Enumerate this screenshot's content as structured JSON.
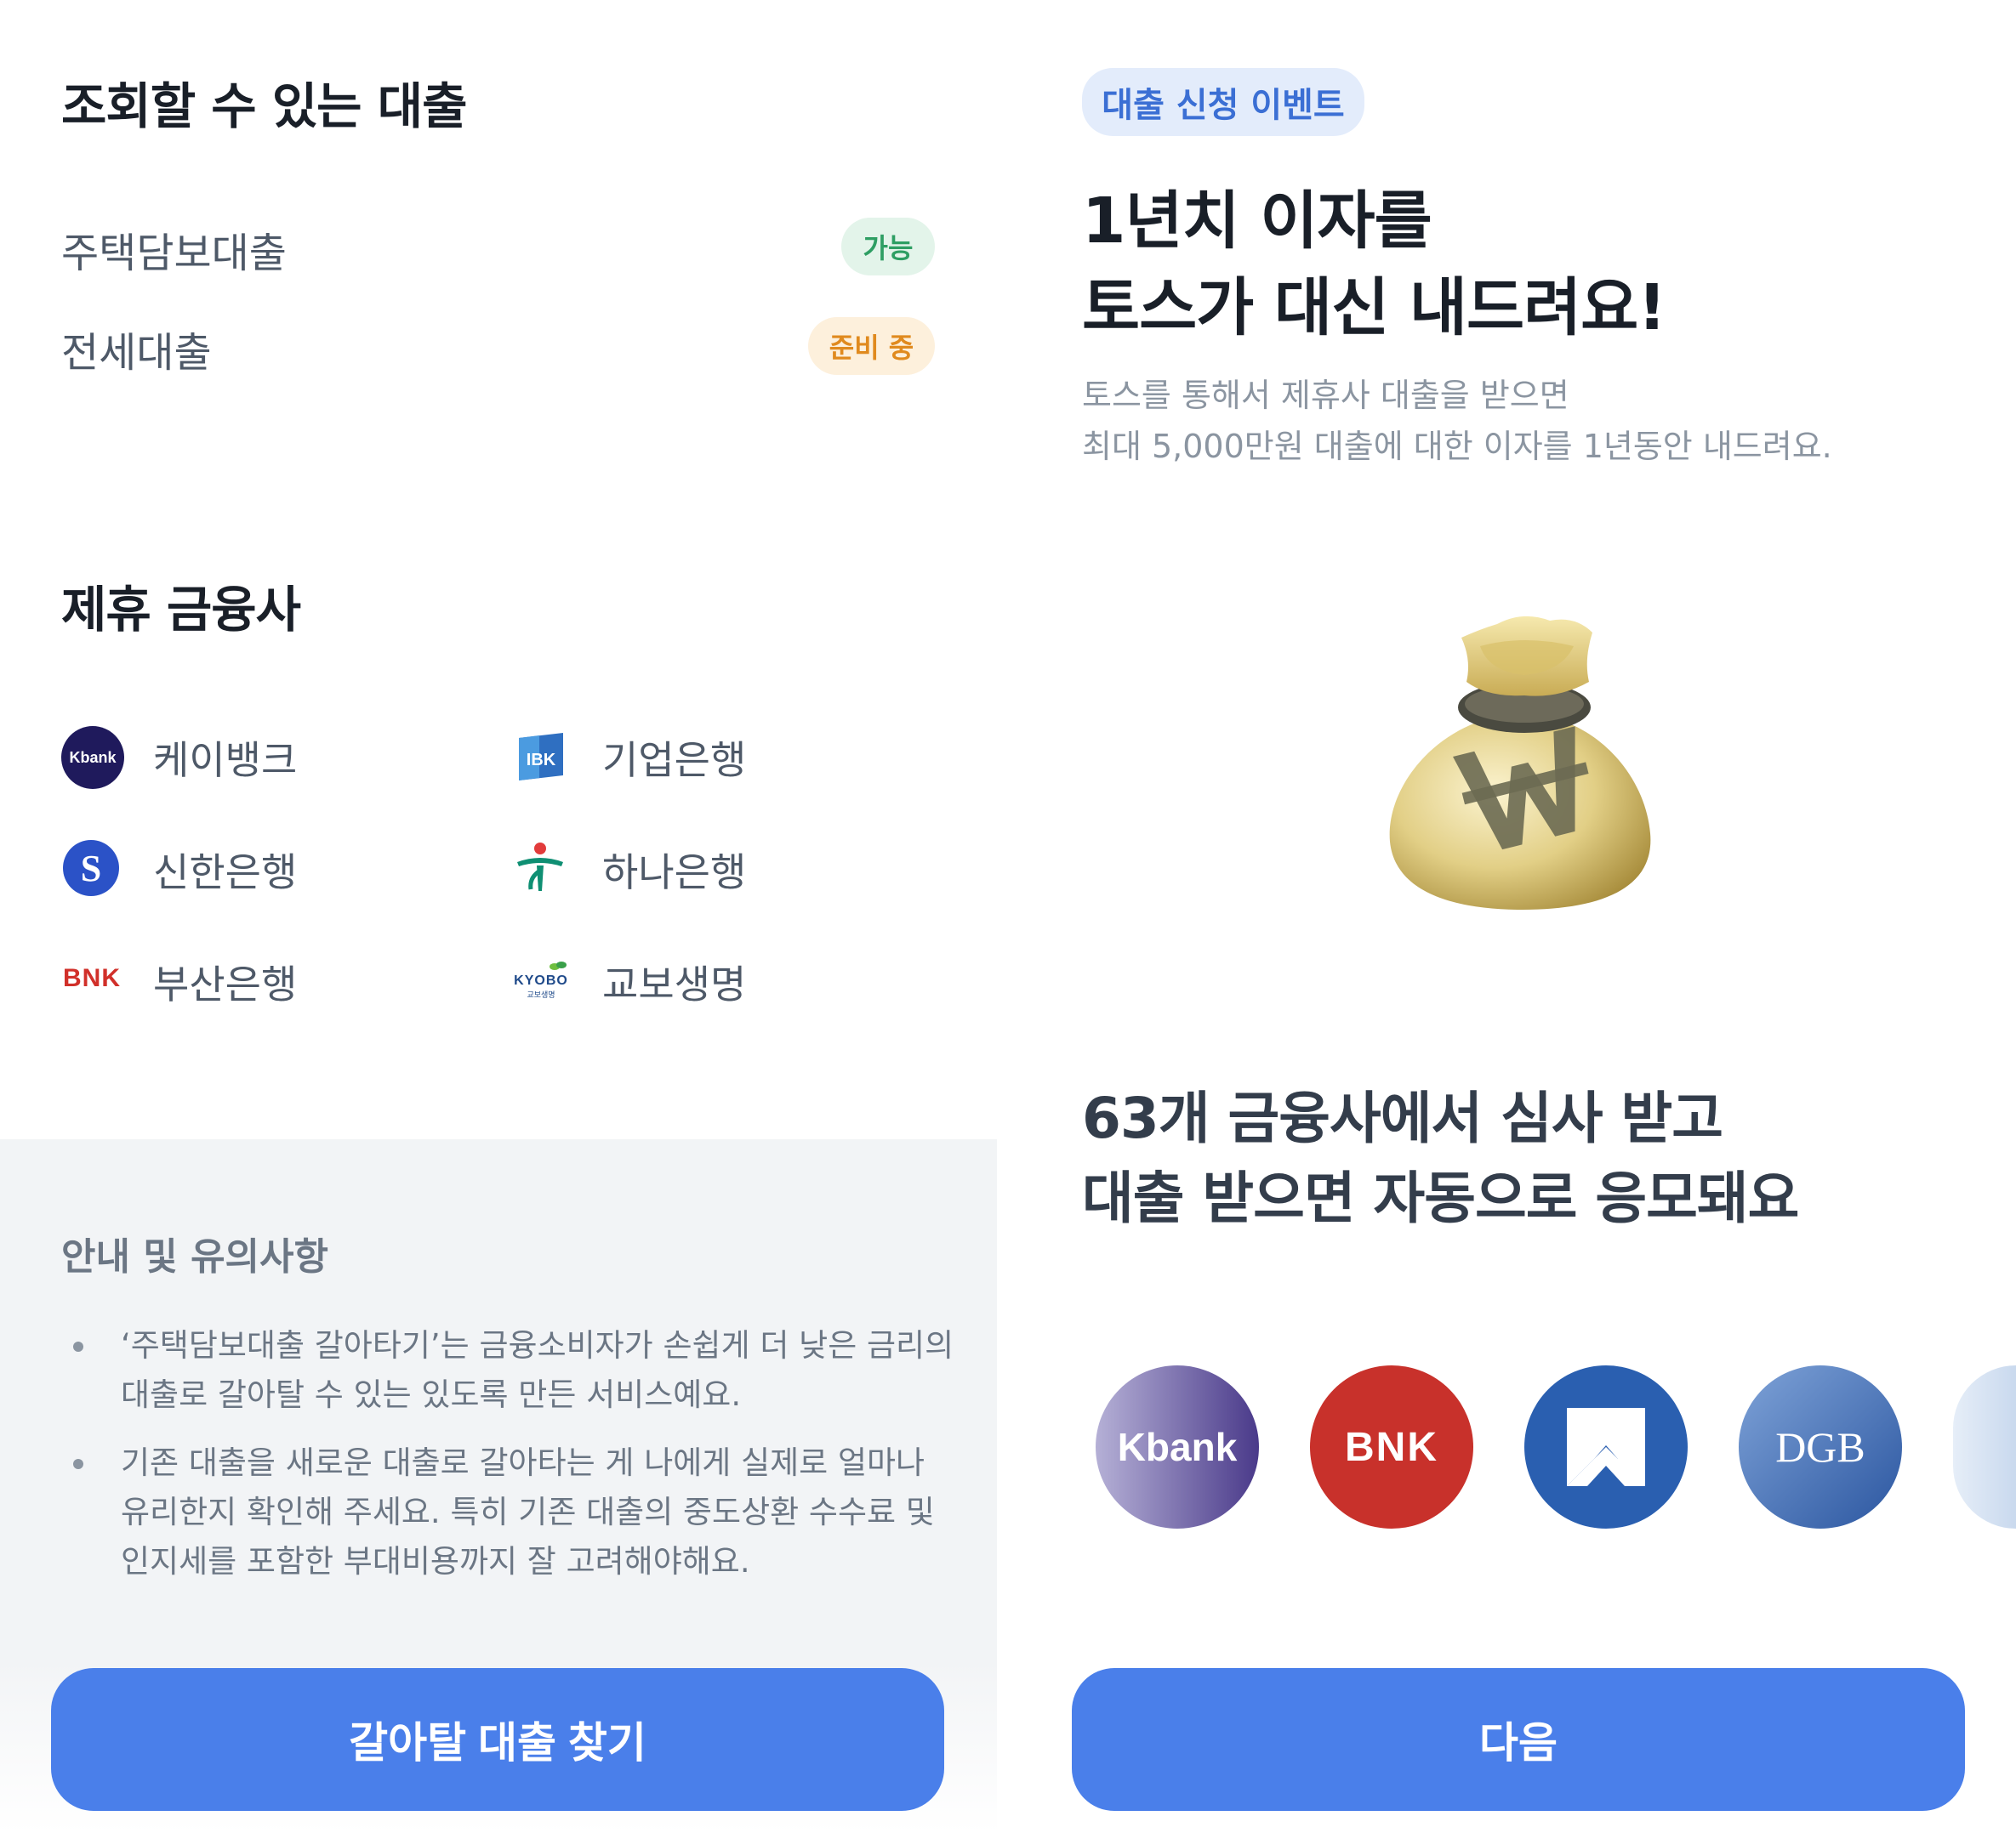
{
  "left": {
    "loans_title": "조회할 수 있는 대출",
    "loans": [
      {
        "name": "주택담보대출",
        "status": "가능"
      },
      {
        "name": "전세대출",
        "status": "준비 중"
      }
    ],
    "partners_title": "제휴 금융사",
    "partners": [
      {
        "name": "케이뱅크",
        "logo_text": "Kbank"
      },
      {
        "name": "기업은행",
        "logo_text": "IBK"
      },
      {
        "name": "신한은행",
        "logo_text": "S"
      },
      {
        "name": "하나은행",
        "logo_text": ""
      },
      {
        "name": "부산은행",
        "logo_text": "BNK"
      },
      {
        "name": "교보생명",
        "logo_text": "KYOBO",
        "logo_subtext": "교보생명"
      }
    ],
    "notice": {
      "title": "안내 및 유의사항",
      "item1": {
        "line1": "‘주택담보대출 갈아타기’는 금융소비자가 손쉽게 더 낮은 금리의",
        "line2": "대출로 갈아탈 수 있는 있도록 만든 서비스예요."
      },
      "item2": {
        "line1": "기존 대출을 새로운 대출로 갈아타는 게 나에게 실제로 얼마나",
        "line2": "유리한지 확인해 주세요. 특히 기존 대출의 중도상환 수수료 및",
        "line3": "인지세를 포함한 부대비용까지 잘 고려해야해요."
      }
    },
    "cta_label": "갈아탈 대출 찾기"
  },
  "right": {
    "event_badge": "대출 신청 이벤트",
    "title_line1": "1년치 이자를",
    "title_line2": "토스가 대신 내드려요!",
    "desc_line1": "토스를 통해서 제휴사 대출을 받으면",
    "desc_line2": "최대 5,000만원 대출에 대한 이자를 1년동안 내드려요.",
    "illustration_icon": "money-bag-icon",
    "headline_line1": "63개 금융사에서 심사 받고",
    "headline_line2": "대출 받으면 자동으로 응모돼요",
    "lenders": [
      {
        "logo_text": "Kbank",
        "color": "#6a5a9a"
      },
      {
        "logo_text": "BNK",
        "color": "#c8312b"
      },
      {
        "logo_text": "",
        "color": "#2a5fb0"
      },
      {
        "logo_text": "DGB",
        "color": "#4f79bd"
      }
    ],
    "cta_label": "다음"
  },
  "colors": {
    "primary": "#4a7fea",
    "badge_ok_bg": "#e3f4ea",
    "badge_ok_text": "#2e9e63",
    "badge_wait_bg": "#fdf0dc",
    "badge_wait_text": "#e08a1e"
  }
}
